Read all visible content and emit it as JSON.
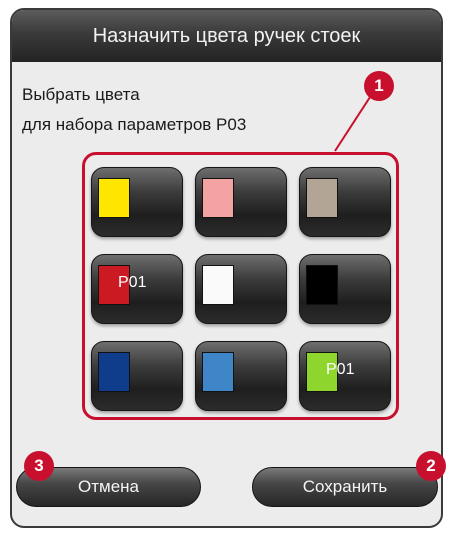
{
  "dialog": {
    "title": "Назначить цвета ручек стоек",
    "instruction_line1": "Выбрать цвета",
    "instruction_line2": "для набора параметров P03"
  },
  "colors": [
    {
      "name": "yellow",
      "hex": "#ffe600",
      "tag": ""
    },
    {
      "name": "pink",
      "hex": "#f4a3a3",
      "tag": ""
    },
    {
      "name": "beige",
      "hex": "#b3a595",
      "tag": ""
    },
    {
      "name": "red",
      "hex": "#cc1a23",
      "tag": "P01"
    },
    {
      "name": "white",
      "hex": "#fafafa",
      "tag": ""
    },
    {
      "name": "black",
      "hex": "#000000",
      "tag": ""
    },
    {
      "name": "dark-blue",
      "hex": "#0f3d8c",
      "tag": ""
    },
    {
      "name": "light-blue",
      "hex": "#3f86c9",
      "tag": ""
    },
    {
      "name": "green",
      "hex": "#8ed62e",
      "tag": "P01"
    }
  ],
  "actions": {
    "cancel_label": "Отмена",
    "save_label": "Сохранить"
  },
  "callouts": {
    "c1": "1",
    "c2": "2",
    "c3": "3"
  }
}
